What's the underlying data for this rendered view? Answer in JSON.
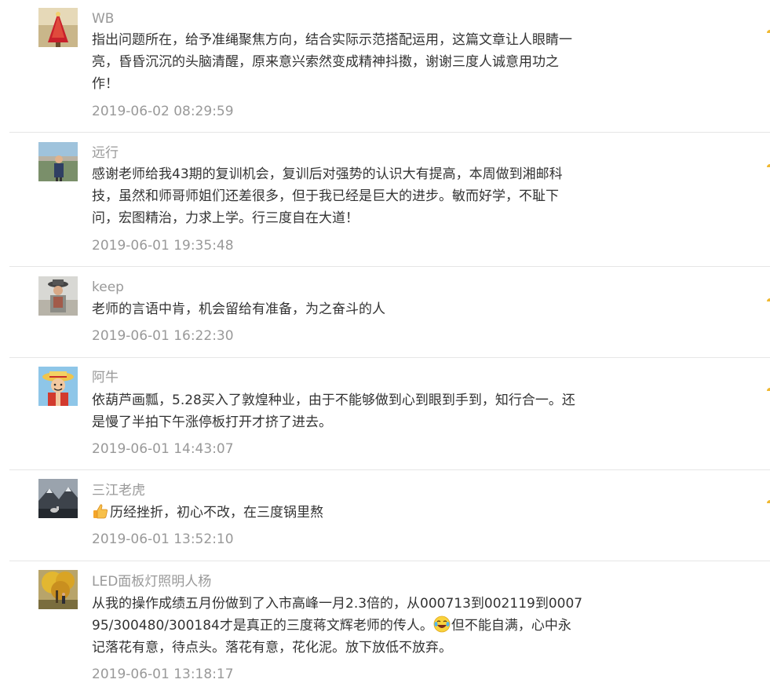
{
  "comments": [
    {
      "user": "WB",
      "lines": [
        "指出问题所在，给予准绳聚焦方向，结合实际示范搭配运用，这篇文章让人眼睛一",
        "亮，昏昏沉沉的头脑清醒，原来意兴索然变成精神抖擞，谢谢三度人诚意用功之",
        "作！"
      ],
      "time": "2019-06-02 08:29:59",
      "avatar": "red-tree-avatar"
    },
    {
      "user": "远行",
      "lines": [
        "感谢老师给我43期的复训机会，复训后对强势的认识大有提高，本周做到湘邮科",
        "技，虽然和师哥师姐们还差很多，但于我已经是巨大的进步。敏而好学，不耻下",
        "问，宏图精治，力求上学。行三度自在大道！"
      ],
      "time": "2019-06-01 19:35:48",
      "avatar": "outdoor-person-avatar"
    },
    {
      "user": "keep",
      "lines": [
        "老师的言语中肯，机会留给有准备，为之奋斗的人"
      ],
      "time": "2019-06-01 16:22:30",
      "avatar": "hat-person-avatar"
    },
    {
      "user": "阿牛",
      "lines": [
        "依葫芦画瓢，5.28买入了敦煌种业，由于不能够做到心到眼到手到，知行合一。还",
        "是慢了半拍下午涨停板打开才挤了进去。"
      ],
      "time": "2019-06-01 14:43:07",
      "avatar": "cartoon-straw-hat-avatar"
    },
    {
      "user": "三江老虎",
      "lines": [
        "历经挫折，初心不改，在三度锅里熬"
      ],
      "time": "2019-06-01 13:52:10",
      "avatar": "mountain-wolf-avatar",
      "emoji": "thumbs-up-emoji"
    },
    {
      "user": "LED面板灯照明人杨",
      "lines": [
        "从我的操作成绩五月份做到了入市高峰一月2.3倍的，从000713到002119到0007",
        "95/300480/300184才是真正的三度蒋文辉老师的传人。",
        "记落花有意，待点头。落花有意，花化泥。放下放低不放弃。"
      ],
      "line2_tail": "但不能自满，心中永",
      "time": "2019-06-01 13:18:17",
      "avatar": "autumn-tree-avatar",
      "emoji": "laughing-tears-emoji"
    }
  ]
}
